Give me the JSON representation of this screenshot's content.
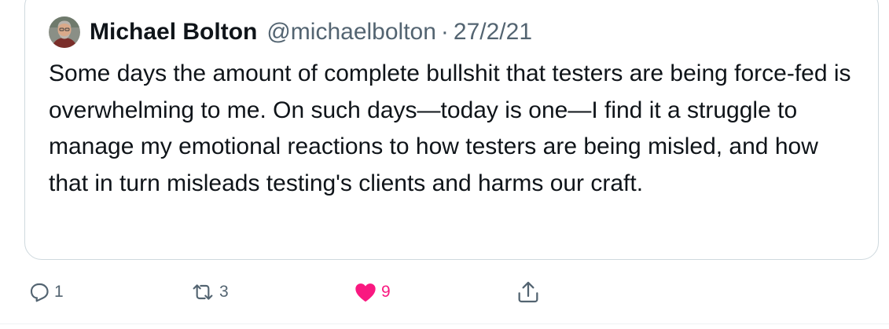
{
  "quoted_tweet": {
    "author": {
      "name": "Michael Bolton",
      "handle": "@michaelbolton"
    },
    "separator": "·",
    "date": "27/2/21",
    "text": "Some days the amount of complete bullshit that testers are being force-fed is overwhelming to me. On such days—today is one—I find it a struggle to manage my emotional reactions to how testers are being misled, and how that in turn misleads testing's clients and harms our craft."
  },
  "actions": {
    "reply": {
      "icon": "reply-icon",
      "count": "1"
    },
    "retweet": {
      "icon": "retweet-icon",
      "count": "3"
    },
    "like": {
      "icon": "heart-filled-icon",
      "count": "9",
      "liked": true
    },
    "share": {
      "icon": "share-icon"
    }
  },
  "colors": {
    "text_primary": "#0f1419",
    "text_secondary": "#536471",
    "border": "#cfd9de",
    "like": "#f91880"
  }
}
